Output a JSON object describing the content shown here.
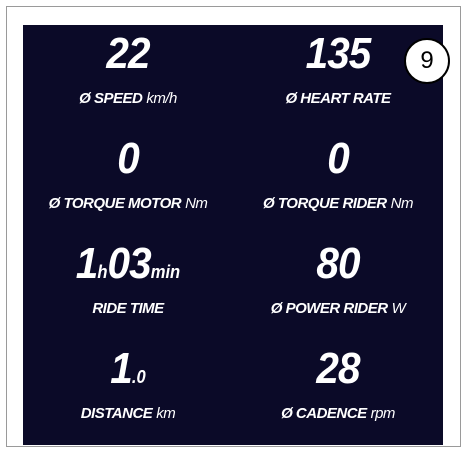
{
  "callout": "9",
  "metrics": {
    "speed": {
      "value": "22",
      "label": "Ø SPEED",
      "unit": "km/h"
    },
    "heart_rate": {
      "value": "135",
      "label": "Ø HEART RATE",
      "unit": ""
    },
    "torque_motor": {
      "value": "0",
      "label": "Ø TORQUE MOTOR",
      "unit": "Nm"
    },
    "torque_rider": {
      "value": "0",
      "label": "Ø TORQUE RIDER",
      "unit": "Nm"
    },
    "ride_time": {
      "hours": "1",
      "hours_unit": "h",
      "minutes": "03",
      "minutes_unit": "min",
      "label": "RIDE TIME"
    },
    "power_rider": {
      "value": "80",
      "label": "Ø POWER RIDER",
      "unit": "W"
    },
    "distance": {
      "value": "1",
      "decimal": ".0",
      "label": "DISTANCE",
      "unit": "km"
    },
    "cadence": {
      "value": "28",
      "label": "Ø CADENCE",
      "unit": "rpm"
    }
  }
}
